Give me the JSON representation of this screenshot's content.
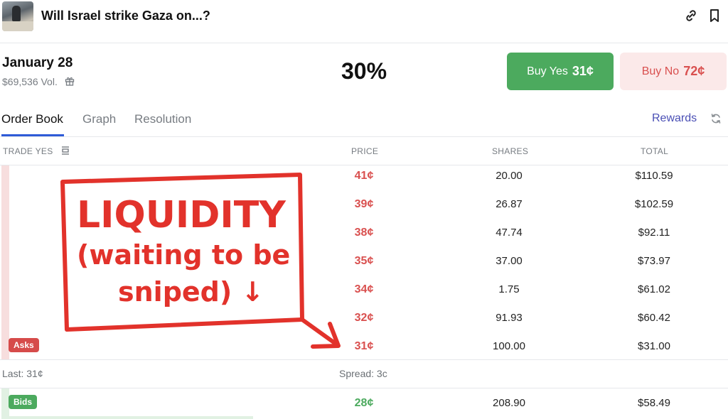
{
  "header": {
    "market_title": "Will Israel strike Gaza on...?",
    "icons": {
      "link": "link-icon",
      "bookmark": "bookmark-icon"
    }
  },
  "summary": {
    "date": "January 28",
    "volume": "$69,536 Vol.",
    "chance": "30%"
  },
  "buy_yes": {
    "label": "Buy Yes",
    "price": "31¢",
    "color": "#4caa5e"
  },
  "buy_no": {
    "label": "Buy No",
    "price": "72¢",
    "color": "#d9504f"
  },
  "tabs": [
    {
      "label": "Order Book",
      "active": true
    },
    {
      "label": "Graph",
      "active": false
    },
    {
      "label": "Resolution",
      "active": false
    }
  ],
  "rewards_label": "Rewards",
  "order_book": {
    "columns": {
      "trade": "TRADE YES",
      "price": "PRICE",
      "shares": "SHARES",
      "total": "TOTAL"
    },
    "asks_label": "Asks",
    "bids_label": "Bids",
    "asks": [
      {
        "price": "41¢",
        "shares": "20.00",
        "total": "$110.59"
      },
      {
        "price": "39¢",
        "shares": "26.87",
        "total": "$102.59"
      },
      {
        "price": "38¢",
        "shares": "47.74",
        "total": "$92.11"
      },
      {
        "price": "35¢",
        "shares": "37.00",
        "total": "$73.97"
      },
      {
        "price": "34¢",
        "shares": "1.75",
        "total": "$61.02"
      },
      {
        "price": "32¢",
        "shares": "91.93",
        "total": "$60.42"
      },
      {
        "price": "31¢",
        "shares": "100.00",
        "total": "$31.00"
      }
    ],
    "last": "Last: 31¢",
    "spread": "Spread: 3c",
    "bids": [
      {
        "price": "28¢",
        "shares": "208.90",
        "total": "$58.49"
      }
    ]
  },
  "annotation": {
    "line1": "LIQUIDITY",
    "line2": "(waiting to be",
    "line3": "sniped) ↓",
    "color": "#e2322b"
  }
}
